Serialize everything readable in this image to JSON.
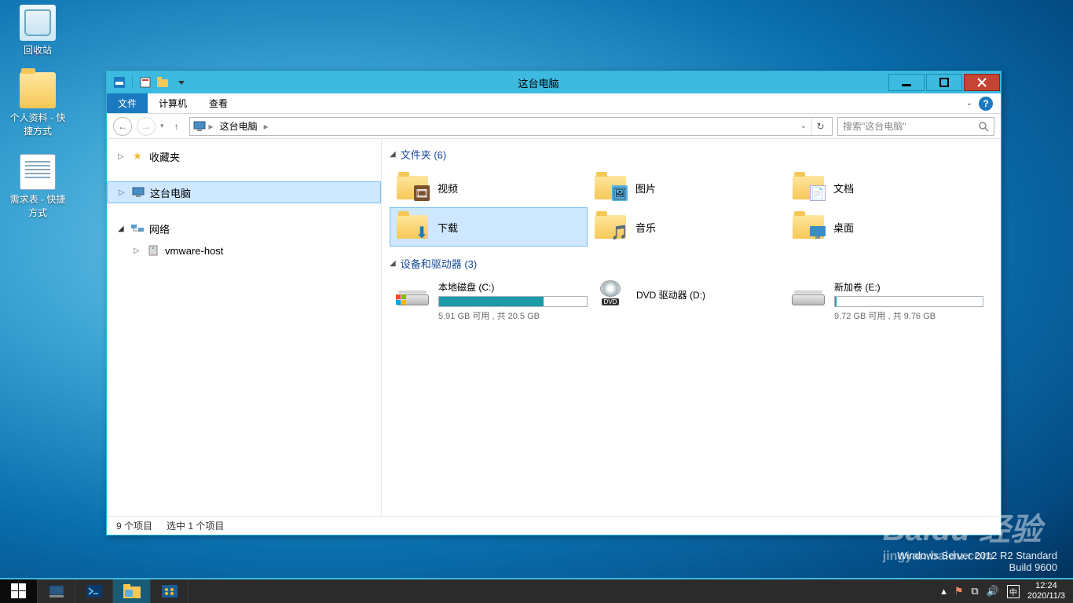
{
  "desktop": {
    "icons": {
      "recycle": "回收站",
      "folder1": "个人资料 - 快捷方式",
      "txt1": "需求表 - 快捷方式"
    }
  },
  "window": {
    "title": "这台电脑",
    "ribbon": {
      "file": "文件",
      "computer": "计算机",
      "view": "查看"
    },
    "address": {
      "crumb1": "这台电脑"
    },
    "search": {
      "placeholder": "搜索\"这台电脑\""
    },
    "nav": {
      "favorites": "收藏夹",
      "thispc": "这台电脑",
      "network": "网络",
      "vmhost": "vmware-host"
    },
    "groups": {
      "folders": "文件夹 (6)",
      "devices": "设备和驱动器 (3)"
    },
    "folders": {
      "videos": "视频",
      "pictures": "图片",
      "documents": "文档",
      "downloads": "下载",
      "music": "音乐",
      "desktop": "桌面"
    },
    "drives": {
      "c": {
        "name": "本地磁盘 (C:)",
        "sub": "5.91 GB 可用 , 共 20.5 GB",
        "fill": 71
      },
      "d": {
        "name": "DVD 驱动器 (D:)"
      },
      "e": {
        "name": "新加卷 (E:)",
        "sub": "9.72 GB 可用 , 共 9.76 GB",
        "fill": 1
      }
    },
    "status": {
      "count": "9 个项目",
      "selected": "选中 1 个项目"
    }
  },
  "watermark": {
    "l1": "Windows Server 2012 R2 Standard",
    "l2": "Build 9600"
  },
  "baidu": {
    "brand": "Baidu 经验",
    "url": "jingyan.baidu.com"
  },
  "taskbar": {
    "time": "12:24",
    "date": "2020/11/3"
  }
}
